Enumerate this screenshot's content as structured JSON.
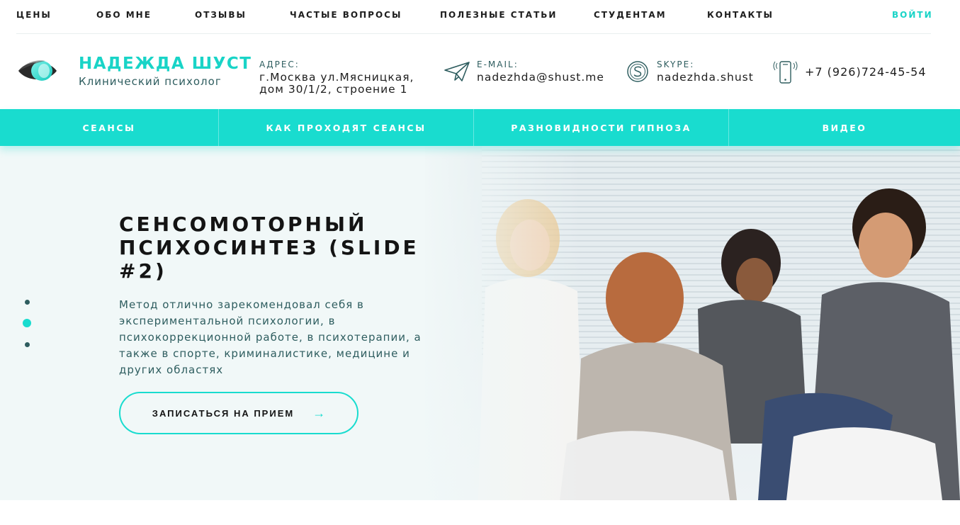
{
  "topnav": {
    "items": [
      "ЦЕНЫ",
      "ОБО МНЕ",
      "ОТЗЫВЫ",
      "ЧАСТЫЕ ВОПРОСЫ",
      "ПОЛЕЗНЫЕ СТАТЬИ",
      "СТУДЕНТАМ",
      "КОНТАКТЫ"
    ],
    "login": "ВОЙТИ"
  },
  "brand": {
    "name": "НАДЕЖДА ШУСТ",
    "role": "Клинический психолог",
    "icon": "eye-logo"
  },
  "contacts": {
    "address": {
      "label": "АДРЕС:",
      "line1": "г.Москва ул.Мясницкая,",
      "line2": "дом 30/1/2, строение 1"
    },
    "email": {
      "label": "E-MAIL:",
      "value": "nadezhda@shust.me",
      "icon": "paper-plane-icon"
    },
    "skype": {
      "label": "SKYPE:",
      "value": "nadezhda.shust",
      "icon": "skype-icon"
    },
    "phone": {
      "value": "+7 (926)724-45-54",
      "icon": "phone-icon"
    }
  },
  "services": {
    "items": [
      "СЕАНСЫ",
      "КАК ПРОХОДЯТ СЕАНСЫ",
      "РАЗНОВИДНОСТИ ГИПНОЗА",
      "ВИДЕО"
    ]
  },
  "hero": {
    "title": "СЕНСОМОТОРНЫЙ ПСИХОСИНТЕЗ (SLIDE #2)",
    "text": "Метод отлично зарекомендовал себя в экспериментальной психологии, в психокоррекционной работе, в психотерапии, а также в спорте, криминалистике, медицине и других областях",
    "button": "ЗАПИСАТЬСЯ НА ПРИЕМ",
    "button_icon": "arrow-right-icon",
    "slides_total": 3,
    "slide_active": 2
  },
  "colors": {
    "accent": "#19dccf",
    "text_dark": "#141414",
    "text_muted": "#2e5d5f",
    "hero_bg": "#f1f8f8"
  }
}
